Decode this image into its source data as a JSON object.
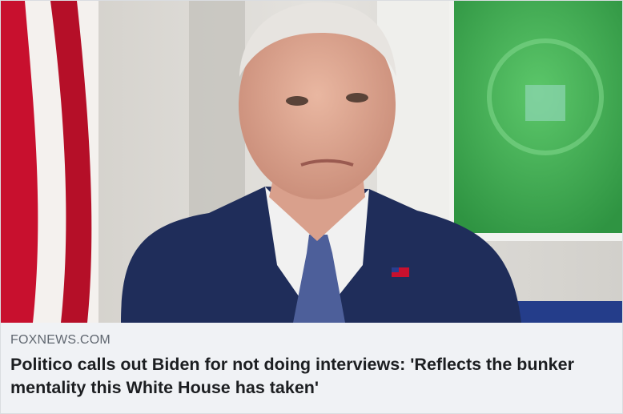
{
  "link_preview": {
    "domain": "FOXNEWS.COM",
    "headline": "Politico calls out Biden for not doing interviews: 'Reflects the bunker mentality this White House has taken'"
  },
  "colors": {
    "caption_background": "#f0f2f5",
    "domain_text": "#606770",
    "headline_text": "#1c1e21",
    "flag_red": "#c8102e",
    "suit_navy": "#1f2d5a",
    "screen_green": "#3fae52"
  }
}
